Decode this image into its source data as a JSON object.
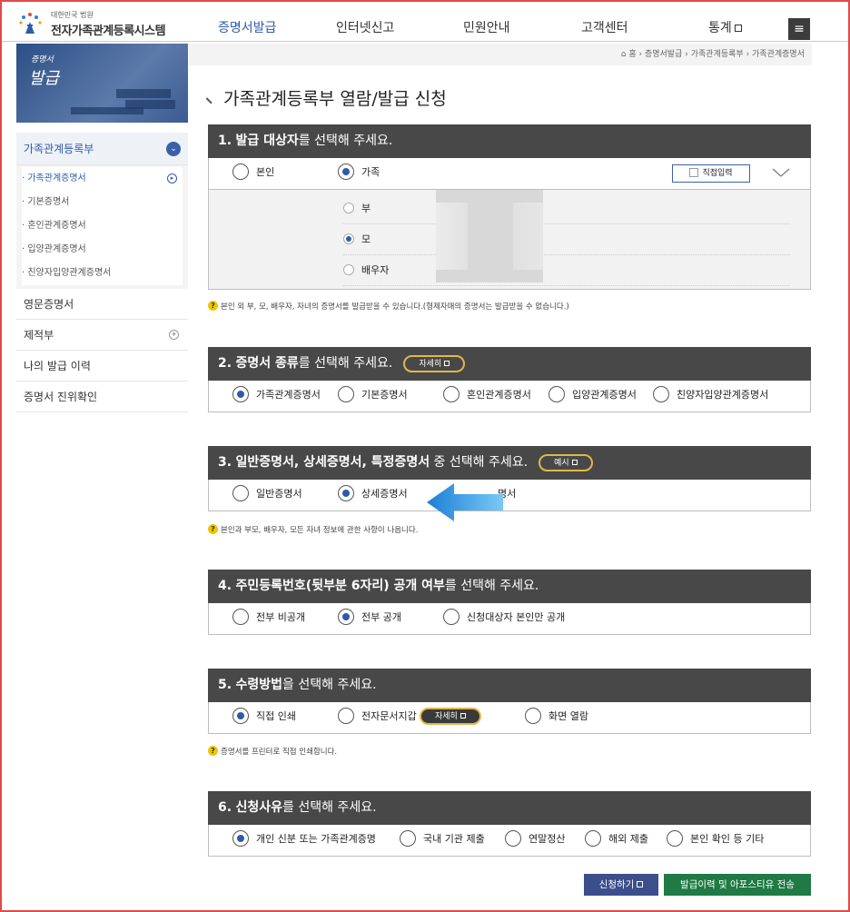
{
  "header": {
    "logo_small": "대한민국 법원",
    "logo_big": "전자가족관계등록시스템",
    "nav": [
      "증명서발급",
      "인터넷신고",
      "민원안내",
      "고객센터",
      "통계"
    ],
    "menu_icon": "hamburger-menu-icon"
  },
  "sidebar": {
    "banner_line1": "증명서",
    "banner_line2": "발급",
    "items": [
      {
        "label": "가족관계등록부"
      },
      {
        "label": "영문증명서"
      },
      {
        "label": "제적부"
      },
      {
        "label": "나의 발급 이력"
      },
      {
        "label": "증명서 진위확인"
      }
    ],
    "subitems": [
      "· 가족관계증명서",
      "· 기본증명서",
      "· 혼인관계증명서",
      "· 입양관계증명서",
      "· 친양자입양관계증명서"
    ]
  },
  "breadcrumb": {
    "home": "홈",
    "items": [
      "증명서발급",
      "가족관계등록부",
      "가족관계증명서"
    ]
  },
  "page_title": "가족관계등록부 열람/발급 신청",
  "sections": [
    {
      "title_num": "1.",
      "title_bold": "발급 대상자",
      "title_rest": "를 선택해 주세요.",
      "options": [
        "본인",
        "가족"
      ],
      "selected": 1,
      "direct_input": "직접입력",
      "family": {
        "options": [
          "부",
          "모",
          "배우자"
        ],
        "selected": 1
      },
      "note": "본인 외 부, 모, 배우자, 자녀의 증명서를 발급받을 수 있습니다.(형제자매의 증명서는 발급받을 수 없습니다.)"
    },
    {
      "title_num": "2.",
      "title_bold": "증명서 종류",
      "title_rest": "를 선택해 주세요.",
      "pill": "자세히",
      "options": [
        "가족관계증명서",
        "기본증명서",
        "혼인관계증명서",
        "입양관계증명서",
        "친양자입양관계증명서"
      ],
      "selected": 0
    },
    {
      "title_num": "3.",
      "title_bold": "일반증명서, 상세증명서, 특정증명서",
      "title_rest": " 중 선택해 주세요.",
      "pill": "예시",
      "options": [
        "일반증명서",
        "상세증명서",
        "특정증명서"
      ],
      "visible_fragment": "명서",
      "selected": 1,
      "note": "본인과 부모, 배우자, 모든 자녀 정보에 관한 사항이 나옵니다."
    },
    {
      "title_num": "4.",
      "title_bold": "주민등록번호(뒷부분 6자리) 공개 여부",
      "title_rest": "를 선택해 주세요.",
      "options": [
        "전부 비공개",
        "전부 공개",
        "신청대상자 본인만 공개"
      ],
      "selected": 1
    },
    {
      "title_num": "5.",
      "title_bold": "수령방법",
      "title_rest": "을 선택해 주세요.",
      "options": [
        "직접 인쇄",
        "전자문서지갑",
        "화면 열람"
      ],
      "pill": "자세히",
      "selected": 0,
      "note": "증명서를 프린터로 직접 인쇄합니다."
    },
    {
      "title_num": "6.",
      "title_bold": "신청사유",
      "title_rest": "를 선택해 주세요.",
      "options": [
        "개인 신분 또는 가족관계증명",
        "국내 기관 제출",
        "연말정산",
        "해외 제출",
        "본인 확인 등 기타"
      ],
      "selected": 0
    }
  ],
  "buttons": {
    "apply": "신청하기",
    "send": "발급이력 및 아포스티유 전송"
  },
  "colors": {
    "accent": "#2f5aa8",
    "section_header": "#484848",
    "pill_border": "#e0b84a",
    "apply_btn": "#3c4f8c",
    "send_btn": "#1f7a45",
    "note_icon": "#f0c400",
    "arrow": "#3aa0e6"
  }
}
